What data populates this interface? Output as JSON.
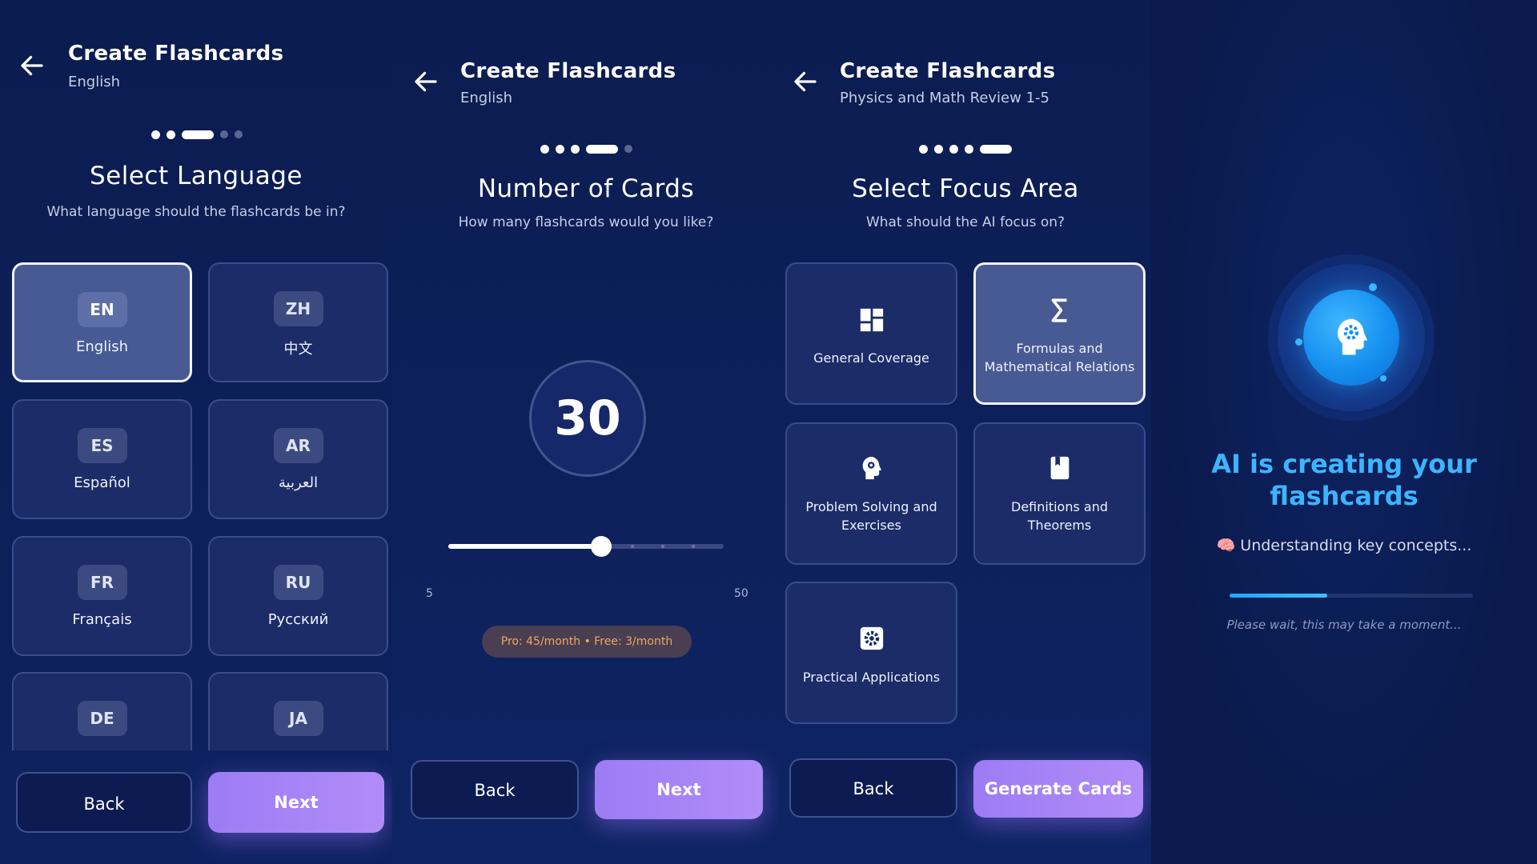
{
  "panel1": {
    "title": "Create Flashcards",
    "subtitle": "English",
    "progress_step": 3,
    "progress_total": 5,
    "step_title": "Select Language",
    "step_subtitle": "What language should the flashcards be in?",
    "languages": [
      {
        "code": "EN",
        "name": "English",
        "selected": true
      },
      {
        "code": "ZH",
        "name": "中文",
        "selected": false
      },
      {
        "code": "ES",
        "name": "Español",
        "selected": false
      },
      {
        "code": "AR",
        "name": "العربية",
        "selected": false
      },
      {
        "code": "FR",
        "name": "Français",
        "selected": false
      },
      {
        "code": "RU",
        "name": "Русский",
        "selected": false
      },
      {
        "code": "DE",
        "name": "",
        "selected": false
      },
      {
        "code": "JA",
        "name": "",
        "selected": false
      }
    ],
    "back_label": "Back",
    "next_label": "Next"
  },
  "panel2": {
    "title": "Create Flashcards",
    "subtitle": "English",
    "progress_step": 4,
    "progress_total": 5,
    "step_title": "Number of Cards",
    "step_subtitle": "How many flashcards would you like?",
    "count": "30",
    "slider_min": "5",
    "slider_max": "50",
    "slider_value": 30,
    "limits": "Pro: 45/month • Free: 3/month",
    "back_label": "Back",
    "next_label": "Next"
  },
  "panel3": {
    "title": "Create Flashcards",
    "subtitle": "Physics and Math Review 1-5",
    "progress_step": 5,
    "progress_total": 5,
    "step_title": "Select Focus Area",
    "step_subtitle": "What should the AI focus on?",
    "focus_areas": [
      {
        "label_1": "General Coverage",
        "label_2": "",
        "icon": "grid-icon",
        "selected": false
      },
      {
        "label_1": "Formulas and",
        "label_2": "Mathematical Relations",
        "icon": "sigma-icon",
        "selected": true
      },
      {
        "label_1": "Problem Solving and",
        "label_2": "Exercises",
        "icon": "head-gear-icon",
        "selected": false
      },
      {
        "label_1": "Definitions and",
        "label_2": "Theorems",
        "icon": "book-icon",
        "selected": false
      },
      {
        "label_1": "Practical Applications",
        "label_2": "",
        "icon": "gear-icon",
        "selected": false
      }
    ],
    "back_label": "Back",
    "generate_label": "Generate Cards"
  },
  "panel4": {
    "title_line1": "AI is creating your",
    "title_line2": "flashcards",
    "status": "🧠 Understanding key concepts...",
    "progress": 0.4,
    "note": "Please wait, this may take a moment..."
  },
  "colors": {
    "background": "#0b1c50",
    "accent_purple": "#a584f6",
    "accent_blue": "#3db4ff",
    "limits_text": "#f0a85a"
  }
}
